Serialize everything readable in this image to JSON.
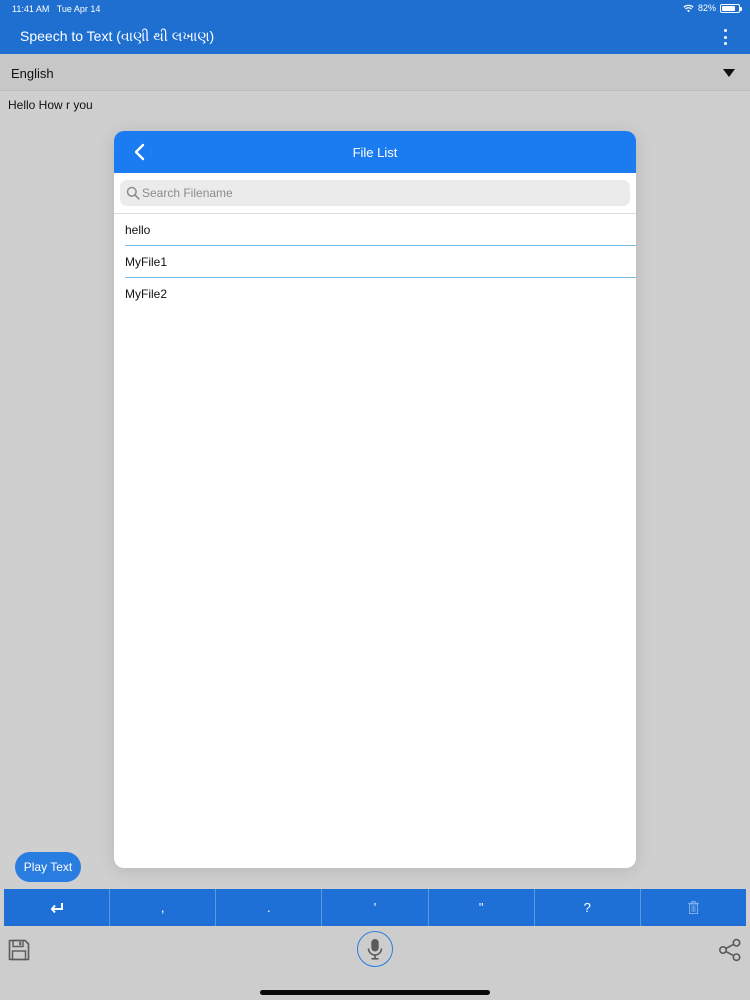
{
  "status_bar": {
    "time": "11:41 AM",
    "date": "Tue Apr 14",
    "battery": "82%",
    "battery_level": 0.82
  },
  "app_bar": {
    "title": "Speech to Text (વાણી થી લખાણ)"
  },
  "language": {
    "selected": "English"
  },
  "editor": {
    "text": "Hello How r you"
  },
  "play_button": {
    "label": "Play Text"
  },
  "modal": {
    "title": "File List",
    "search_placeholder": "Search Filename",
    "files": [
      "hello",
      "MyFile1",
      "MyFile2"
    ]
  },
  "punctuation_keys": [
    "↵",
    ",",
    ".",
    "'",
    "\"",
    "?",
    "trash-icon"
  ],
  "footer": {
    "icons": [
      "save-icon",
      "mic-icon",
      "share-icon"
    ]
  },
  "colors": {
    "primary": "#1f6fd1",
    "modal_header": "#1a7cf0",
    "button": "#2a7de0"
  }
}
